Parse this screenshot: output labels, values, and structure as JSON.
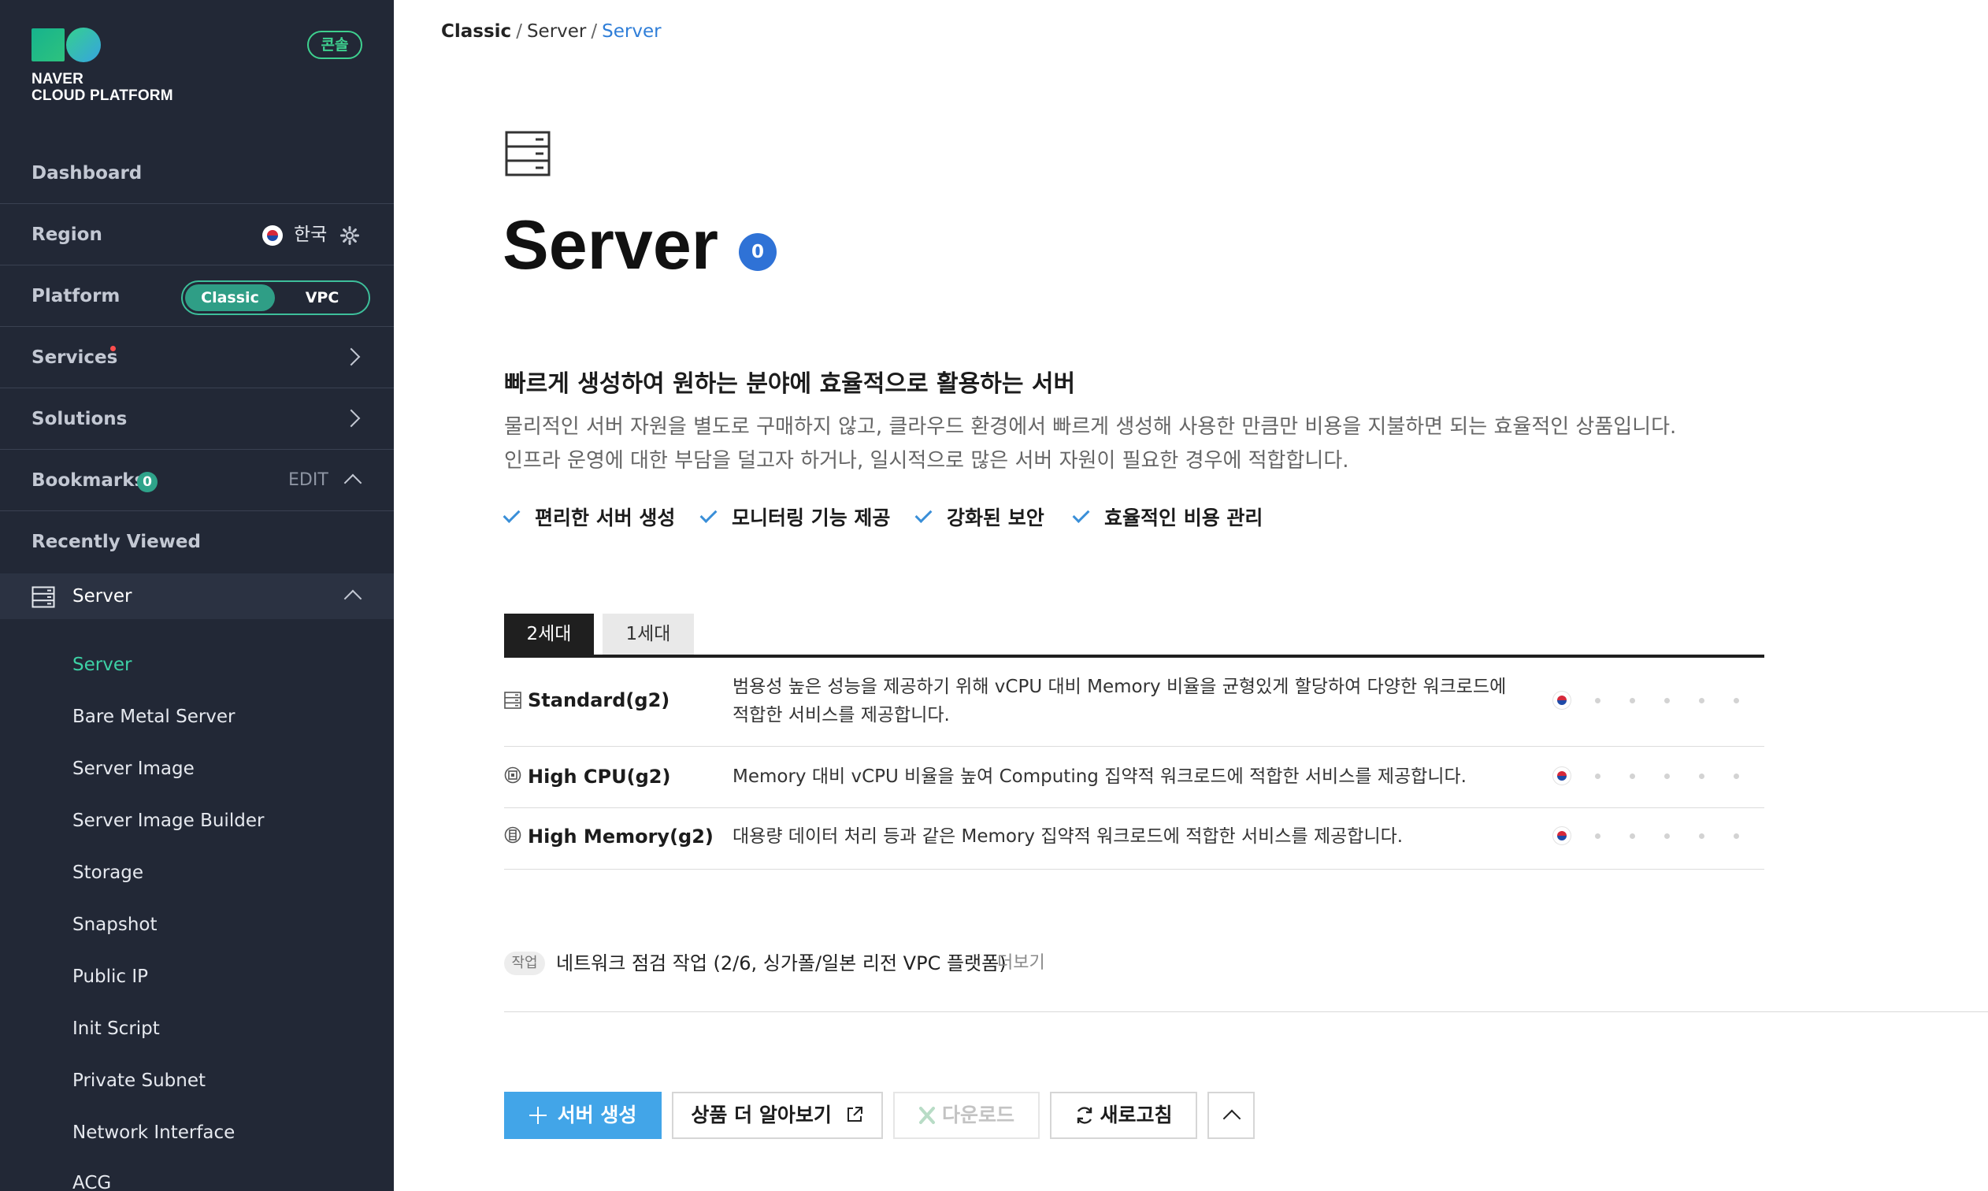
{
  "sidebar": {
    "logo_lines": [
      "NAVER",
      "CLOUD PLATFORM"
    ],
    "console_badge": "콘솔",
    "dashboard": "Dashboard",
    "region": {
      "label": "Region",
      "value": "한국"
    },
    "platform": {
      "label": "Platform",
      "options": [
        "Classic",
        "VPC"
      ],
      "selected": "Classic"
    },
    "services": "Services",
    "solutions": "Solutions",
    "bookmarks": {
      "label": "Bookmarks",
      "count": "0",
      "edit": "EDIT"
    },
    "recently_viewed": "Recently Viewed",
    "group": {
      "label": "Server"
    },
    "items": [
      "Server",
      "Bare Metal Server",
      "Server Image",
      "Server Image Builder",
      "Storage",
      "Snapshot",
      "Public IP",
      "Init Script",
      "Private Subnet",
      "Network Interface",
      "ACG"
    ],
    "active_item": "Server"
  },
  "breadcrumb": [
    "Classic",
    "Server",
    "Server"
  ],
  "page": {
    "title": "Server",
    "count": "0",
    "headline": "빠르게 생성하여 원하는 분야에 효율적으로 활용하는 서버",
    "description": [
      "물리적인 서버 자원을 별도로 구매하지 않고, 클라우드 환경에서 빠르게 생성해 사용한 만큼만 비용을 지불하면 되는 효율적인 상품입니다.",
      "인프라 운영에 대한 부담을 덜고자 하거나, 일시적으로 많은 서버 자원이 필요한 경우에 적합합니다."
    ],
    "features": [
      "편리한 서버 생성",
      "모니터링 기능 제공",
      "강화된 보안",
      "효율적인 비용 관리"
    ]
  },
  "tabs": [
    "2세대",
    "1세대"
  ],
  "active_tab": "2세대",
  "products": [
    {
      "icon": "server-icon",
      "name": "Standard(g2)",
      "desc": "범용성 높은 성능을 제공하기 위해 vCPU 대비 Memory 비율을 균형있게 할당하여 다양한 워크로드에 적합한 서비스를 제공합니다."
    },
    {
      "icon": "cpu-icon",
      "name": "High CPU(g2)",
      "desc": "Memory 대비 vCPU 비율을 높여 Computing 집약적 워크로드에 적합한 서비스를 제공합니다."
    },
    {
      "icon": "memory-icon",
      "name": "High Memory(g2)",
      "desc": "대용량 데이터 처리 등과 같은 Memory 집약적 워크로드에 적합한 서비스를 제공합니다."
    }
  ],
  "notice": {
    "tag": "작업",
    "text": "네트워크 점검 작업 (2/6, 싱가폴/일본 리전 VPC 플랫폼)",
    "more": "더보기"
  },
  "actions": {
    "create": "서버 생성",
    "learn_more": "상품 더 알아보기",
    "download": "다운로드",
    "refresh": "새로고침"
  },
  "colors": {
    "sidebar_bg": "#222836",
    "accent_green": "#3dd1a5",
    "primary_blue": "#42a5e8",
    "badge_blue": "#2f72d6",
    "link_blue": "#2f7ed8"
  }
}
